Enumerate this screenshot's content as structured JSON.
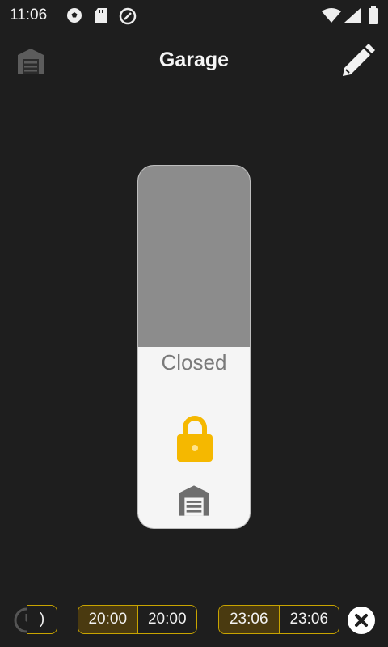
{
  "status": {
    "time": "11:06"
  },
  "header": {
    "title": "Garage"
  },
  "device": {
    "state": "Closed",
    "fill_fraction": 0.5
  },
  "schedule": {
    "partial_label": ")",
    "pills": [
      {
        "start": "20:00",
        "end": "20:00"
      },
      {
        "start": "23:06",
        "end": "23:06"
      }
    ]
  },
  "colors": {
    "accent": "#f5b800",
    "pill_border": "#c8a400"
  }
}
